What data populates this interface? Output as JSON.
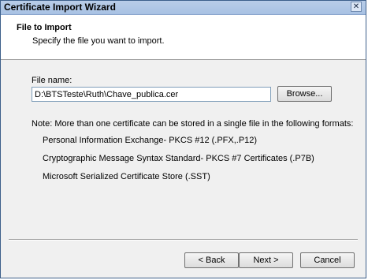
{
  "window": {
    "title": "Certificate Import Wizard",
    "close_glyph": "✕"
  },
  "header": {
    "title": "File to Import",
    "subtitle": "Specify the file you want to import."
  },
  "file": {
    "label": "File name:",
    "value": "D:\\BTSTeste\\Ruth\\Chave_publica.cer",
    "browse_label": "Browse..."
  },
  "note": {
    "text": "Note:  More than one certificate can be stored in a single file in the following formats:",
    "formats": [
      "Personal Information Exchange- PKCS #12 (.PFX,.P12)",
      "Cryptographic Message Syntax Standard- PKCS #7 Certificates (.P7B)",
      "Microsoft Serialized Certificate Store (.SST)"
    ]
  },
  "footer": {
    "back_label": "< Back",
    "next_label": "Next >",
    "cancel_label": "Cancel"
  }
}
